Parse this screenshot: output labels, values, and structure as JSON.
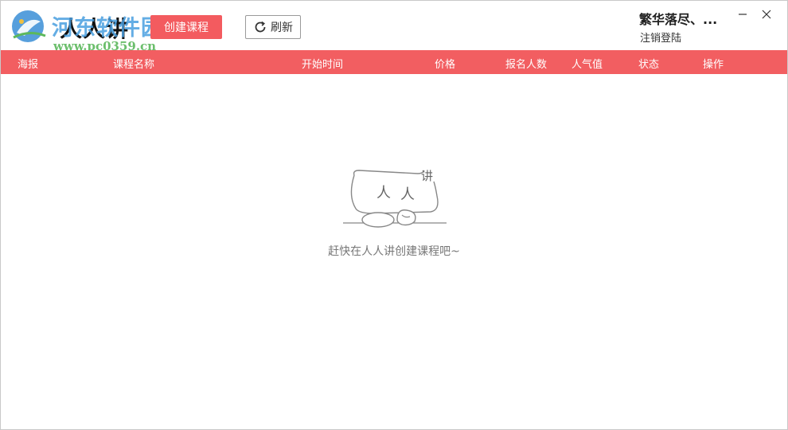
{
  "app": {
    "title": "人人讲",
    "watermark_name": "河东软件园",
    "watermark_url": "www.pc0359.cn"
  },
  "toolbar": {
    "create_label": "创建课程",
    "refresh_label": "刷新"
  },
  "user": {
    "name": "繁华落尽、...",
    "logout_label": "注销登陆"
  },
  "table": {
    "columns": [
      "海报",
      "课程名称",
      "开始时间",
      "价格",
      "报名人数",
      "人气值",
      "状态",
      "操作"
    ]
  },
  "empty_state": {
    "illustration_text_left": "人",
    "illustration_text_right": "人",
    "illustration_text_top": "讲",
    "message": "赶快在人人讲创建课程吧~"
  },
  "colors": {
    "accent": "#f25e61",
    "watermark_blue": "#4a9fe0",
    "watermark_green": "#5cb85c"
  }
}
